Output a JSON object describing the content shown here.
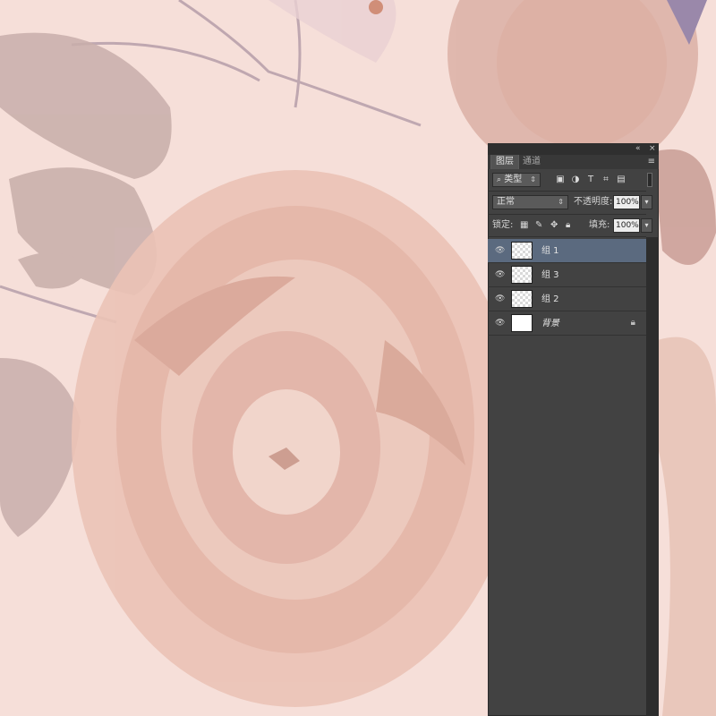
{
  "panel": {
    "tabs": [
      {
        "label": "图层",
        "active": true
      },
      {
        "label": "通道",
        "active": false
      }
    ],
    "filter": {
      "kind_label": "类型",
      "icons": [
        "image-filter-icon",
        "adjustment-filter-icon",
        "type-filter-icon",
        "shape-filter-icon",
        "smart-object-filter-icon"
      ]
    },
    "blend_mode": "正常",
    "opacity_label": "不透明度:",
    "opacity_value": "100%",
    "lock_label": "锁定:",
    "fill_label": "填充:",
    "fill_value": "100%"
  },
  "layers": [
    {
      "name": "组 1",
      "selected": true,
      "italic": false,
      "locked": false
    },
    {
      "name": "组 3",
      "selected": false,
      "italic": false,
      "locked": false
    },
    {
      "name": "组 2",
      "selected": false,
      "italic": false,
      "locked": false
    },
    {
      "name": "背景",
      "selected": false,
      "italic": true,
      "locked": true
    }
  ],
  "colors": {
    "panel_bg": "#424242",
    "selection": "#5b6a7f",
    "canvas_tint": "#f6dfd9"
  }
}
